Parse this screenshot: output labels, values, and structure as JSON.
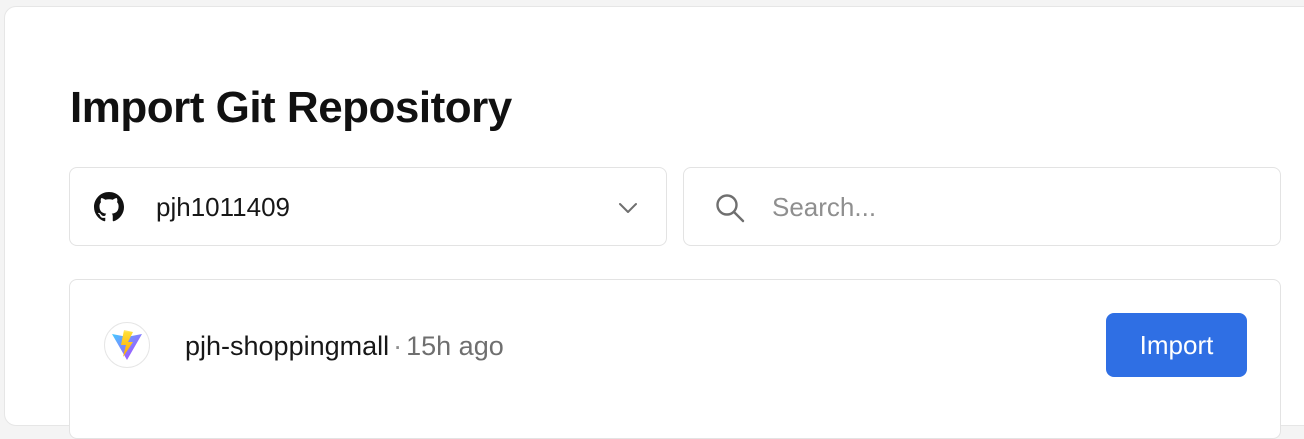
{
  "page": {
    "title": "Import Git Repository"
  },
  "account_selector": {
    "icon": "github-icon",
    "value": "pjh1011409",
    "dropdown_icon": "chevron-down-icon"
  },
  "search": {
    "icon": "search-icon",
    "placeholder": "Search..."
  },
  "repositories": [
    {
      "icon": "vite-logo-icon",
      "name": "pjh-shoppingmall",
      "separator": "·",
      "updated": "15h ago",
      "action_label": "Import"
    }
  ],
  "colors": {
    "accent": "#2f6fe4",
    "text_primary": "#171717",
    "text_muted": "#6f6f6f",
    "border": "#e3e3e3"
  }
}
